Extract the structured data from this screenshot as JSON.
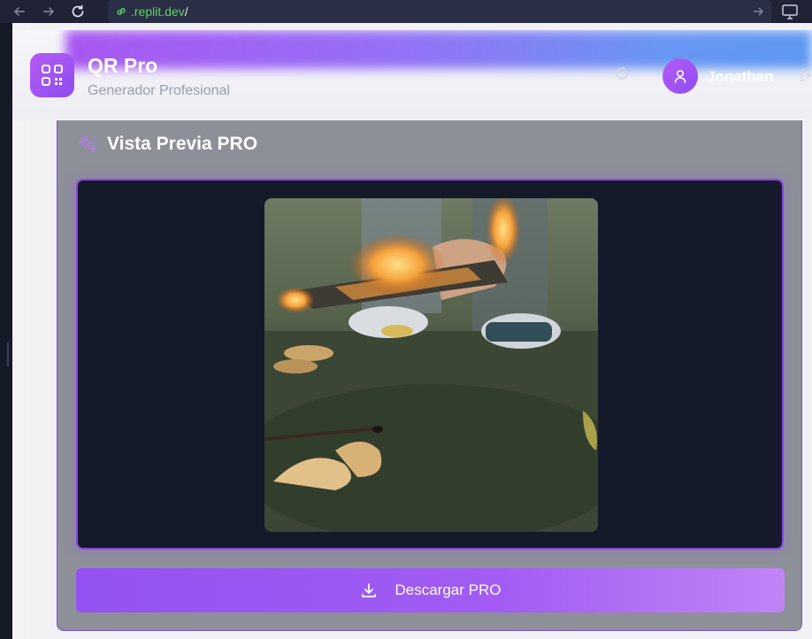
{
  "browser": {
    "url_domain": ".replit.dev",
    "url_path": "/"
  },
  "header": {
    "title": "QR Pro",
    "subtitle": "Generador Profesional",
    "user_name": "Jonathan",
    "accent_gradient": [
      "#a046f0",
      "#5a8cf3"
    ]
  },
  "preview": {
    "title": "Vista Previa PRO",
    "image_description_icon": "photo-burning-paper"
  },
  "actions": {
    "download_label": "Descargar PRO"
  },
  "colors": {
    "accent": "#9452f2",
    "panel_bg": "#141a2a",
    "card_bg": "#8d8f99",
    "url_green": "#5fd36a"
  },
  "icons": {
    "back": "arrow-left-icon",
    "forward": "arrow-right-icon",
    "reload": "reload-icon",
    "link": "link-icon",
    "logo": "qr-code-icon",
    "sparkle": "sparkles-icon",
    "user": "user-icon",
    "logout": "logout-icon",
    "download": "download-icon"
  }
}
